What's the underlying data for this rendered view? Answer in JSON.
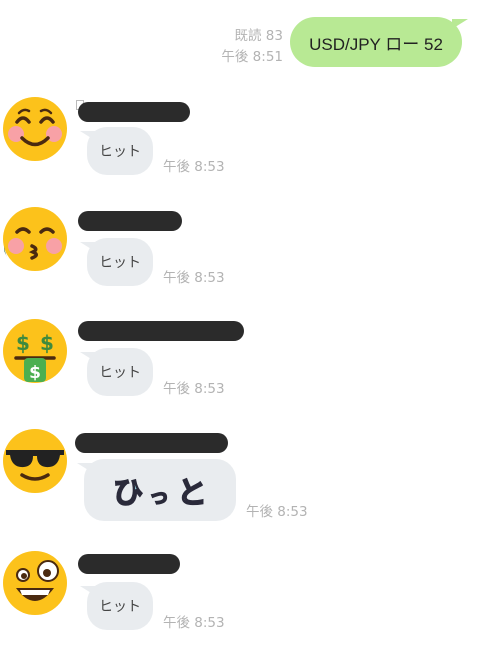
{
  "sent": {
    "read_label": "既読 83",
    "time": "午後 8:51",
    "text": "USD/JPY ロー 52"
  },
  "messages": [
    {
      "avatar_icon": "smiling-blush-emoji-icon",
      "text": "ヒット",
      "time": "午後 8:53"
    },
    {
      "avatar_icon": "kissing-closed-eyes-emoji-icon",
      "text": "ヒット",
      "time": "午後 8:53"
    },
    {
      "avatar_icon": "money-mouth-emoji-icon",
      "text": "ヒット",
      "time": "午後 8:53"
    },
    {
      "avatar_icon": "sunglasses-emoji-icon",
      "text": "ひっと",
      "time": "午後 8:53"
    },
    {
      "avatar_icon": "zany-face-emoji-icon",
      "text": "ヒット",
      "time": "午後 8:53"
    }
  ],
  "colors": {
    "sent_bubble": "#b8e994",
    "received_bubble": "#e9ecef",
    "meta_text": "#b3b3b3",
    "redaction": "#2b2b2b"
  }
}
